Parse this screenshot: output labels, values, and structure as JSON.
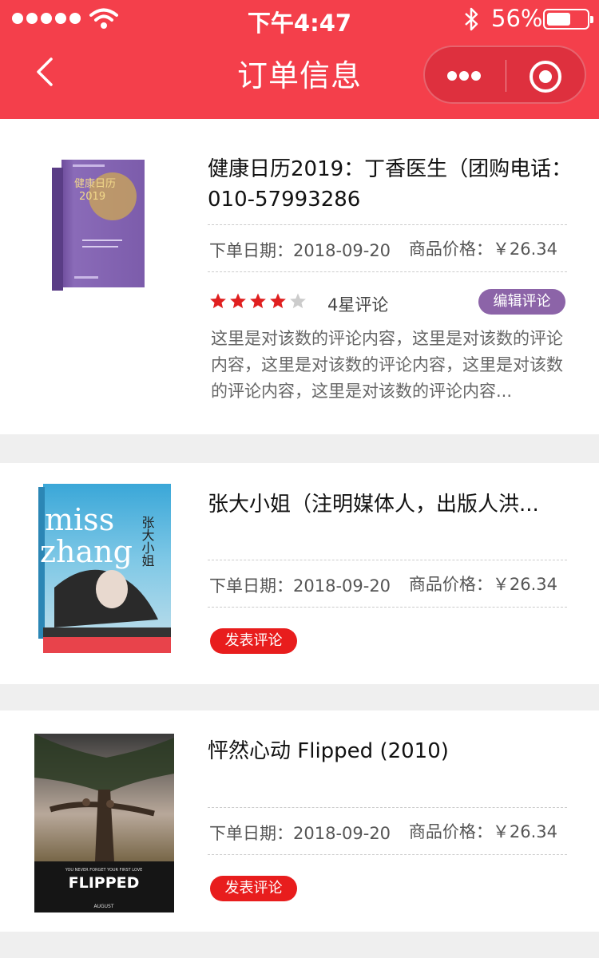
{
  "status_bar": {
    "time": "下午4:47",
    "battery_percent": "56%",
    "battery_level": 0.56
  },
  "nav": {
    "title": "订单信息"
  },
  "orders": [
    {
      "name": "健康日历2019：丁香医生（团购电话：010-57993286",
      "date": "下单日期：2018-09-20",
      "price": "商品价格：￥26.34",
      "rating": 4,
      "rating_text": "4星评论",
      "action": "编辑评论",
      "review": "这里是对该数的评论内容，这里是对该数的评论内容，这里是对该数的评论内容，这里是对该数的评论内容，这里是对该数的评论内容...",
      "cover_text": [
        "健康日历",
        "2019"
      ]
    },
    {
      "name": "张大小姐（注明媒体人，出版人洪...",
      "date": "下单日期：2018-09-20",
      "price": "商品价格：￥26.34",
      "action": "发表评论",
      "cover_text": [
        "miss",
        "zhang",
        "张大小姐"
      ]
    },
    {
      "name": "怦然心动 Flipped (2010)",
      "date": "下单日期：2018-09-20",
      "price": "商品价格：￥26.34",
      "action": "发表评论",
      "cover_text": [
        "YOU NEVER FORGET YOUR FIRST LOVE",
        "FLIPPED",
        "AUGUST"
      ]
    }
  ],
  "colors": {
    "header": "#f43f4b",
    "edit_button": "#8c64a8",
    "post_button": "#e81d1d",
    "star_on": "#e02020",
    "star_off": "#cccccc"
  }
}
